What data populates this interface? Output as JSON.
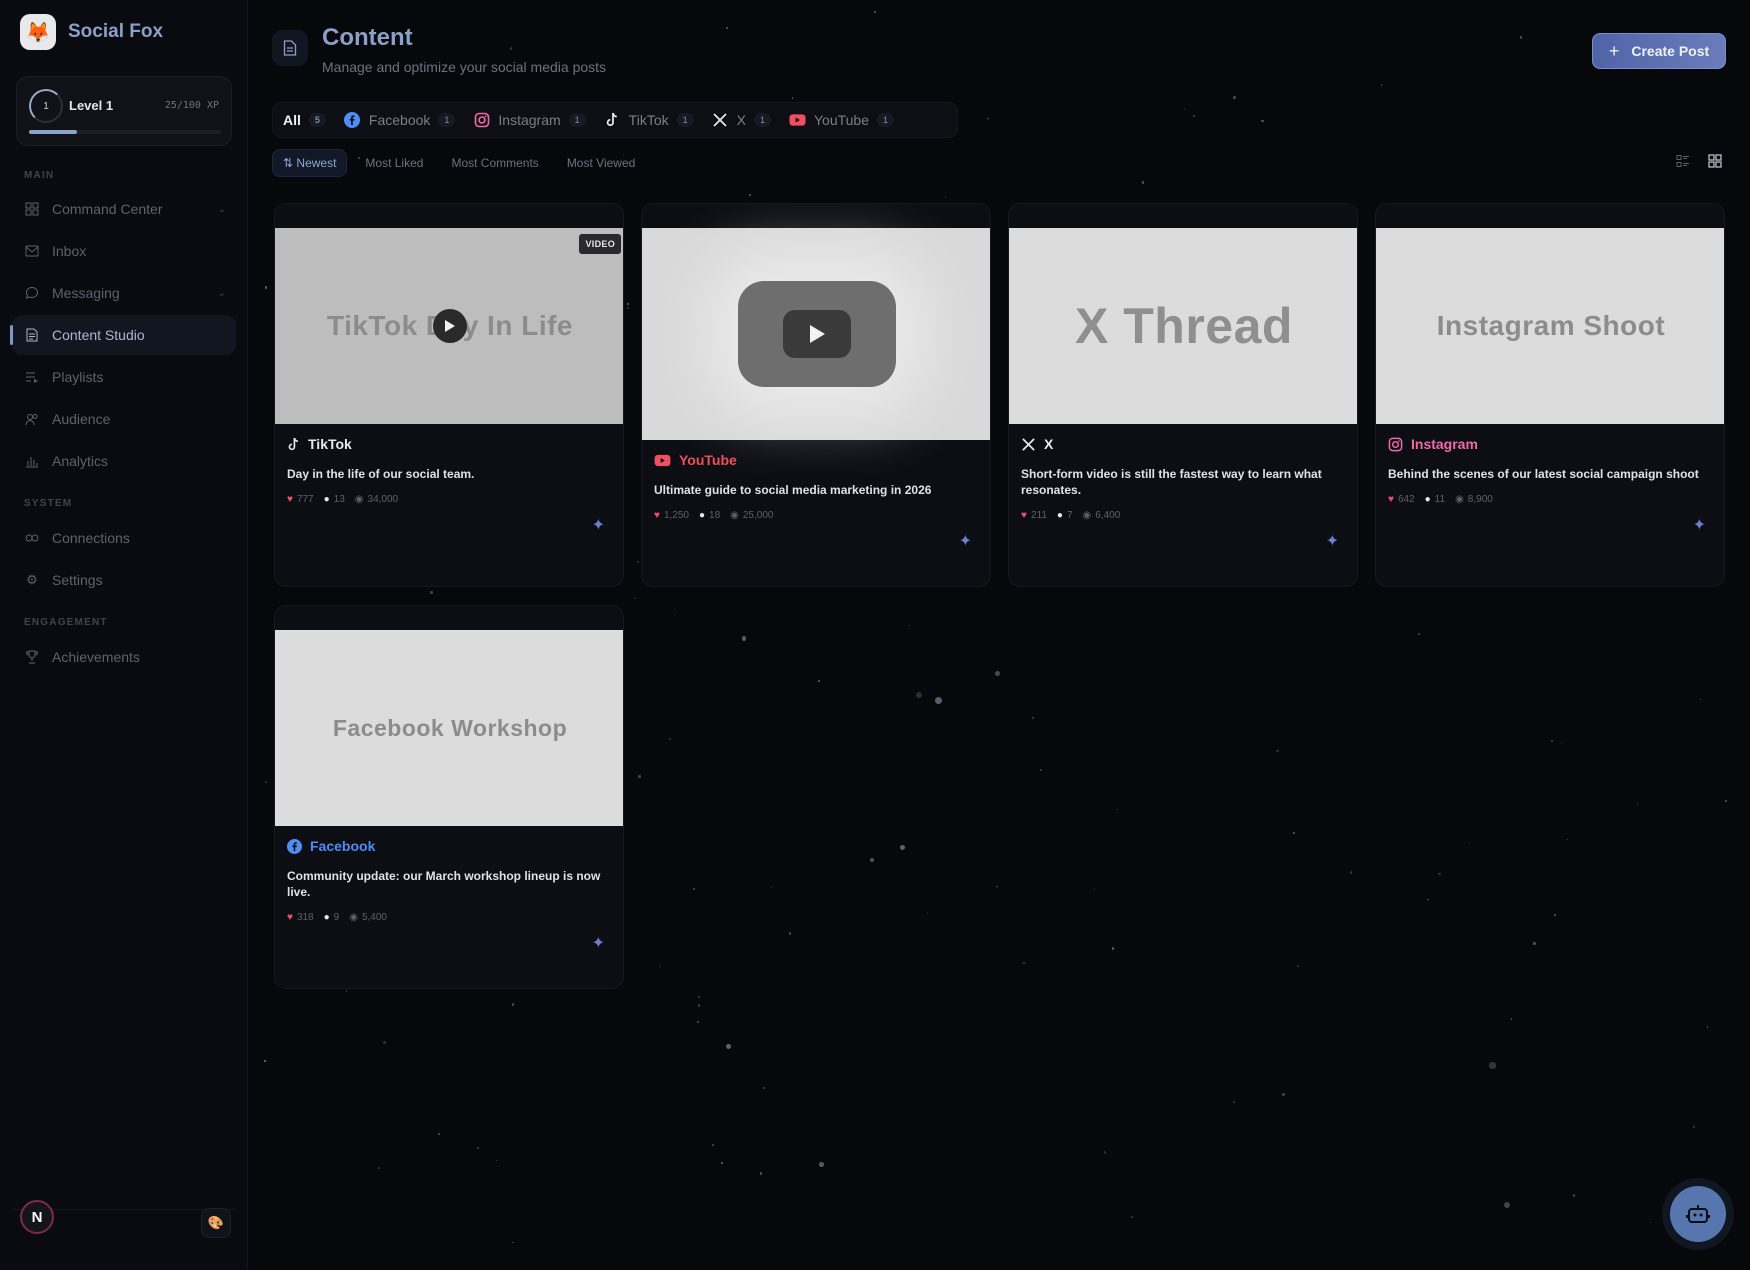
{
  "app": {
    "name": "Social Fox"
  },
  "level": {
    "label": "Level 1",
    "number": "1",
    "xp": "25/100 XP",
    "progress": 0.25
  },
  "nav": {
    "sections": {
      "main": "MAIN",
      "system": "SYSTEM",
      "engagement": "ENGAGEMENT"
    },
    "items": [
      {
        "label": "Command Center",
        "icon": "grid-icon",
        "chevron": true
      },
      {
        "label": "Inbox",
        "icon": "mail-icon"
      },
      {
        "label": "Messaging",
        "icon": "chat-icon",
        "chevron": true
      },
      {
        "label": "Content Studio",
        "icon": "document-icon",
        "active": true
      },
      {
        "label": "Playlists",
        "icon": "playlist-icon"
      },
      {
        "label": "Audience",
        "icon": "users-icon"
      },
      {
        "label": "Analytics",
        "icon": "bar-chart-icon"
      },
      {
        "label": "Connections",
        "icon": "link-icon"
      },
      {
        "label": "Settings",
        "icon": "gear-icon"
      },
      {
        "label": "Achievements",
        "icon": "trophy-icon"
      }
    ]
  },
  "user": {
    "initial": "N"
  },
  "header": {
    "title": "Content",
    "subtitle": "Manage and optimize your social media posts",
    "create_label": "Create Post"
  },
  "platform_tabs": [
    {
      "label": "All",
      "count": "5",
      "active": true
    },
    {
      "label": "Facebook",
      "count": "1",
      "icon": "facebook-icon"
    },
    {
      "label": "Instagram",
      "count": "1",
      "icon": "instagram-icon"
    },
    {
      "label": "TikTok",
      "count": "1",
      "icon": "tiktok-icon"
    },
    {
      "label": "X",
      "count": "1",
      "icon": "x-icon"
    },
    {
      "label": "YouTube",
      "count": "1",
      "icon": "youtube-icon"
    }
  ],
  "sort": {
    "options": [
      "Newest",
      "Most Liked",
      "Most Comments",
      "Most Viewed"
    ],
    "active": "Newest"
  },
  "posts": [
    {
      "platform": "TikTok",
      "color": "#e8e8ee",
      "thumb_text": "TikTok Day In Life",
      "badge": "VIDEO",
      "text": "Day in the life of our social team.",
      "likes": "777",
      "comments": "13",
      "views": "34,000"
    },
    {
      "platform": "YouTube",
      "color": "#ef4f5f",
      "text": "Ultimate guide to social media marketing in 2026",
      "likes": "1,250",
      "comments": "18",
      "views": "25,000"
    },
    {
      "platform": "X",
      "color": "#e8e8ee",
      "thumb_text": "X Thread",
      "text": "Short-form video is still the fastest way to learn what resonates.",
      "likes": "211",
      "comments": "7",
      "views": "6,400"
    },
    {
      "platform": "Instagram",
      "color": "#f06aa8",
      "thumb_text": "Instagram Shoot",
      "text": "Behind the scenes of our latest social campaign shoot",
      "likes": "642",
      "comments": "11",
      "views": "8,900"
    },
    {
      "platform": "Facebook",
      "color": "#4f8df5",
      "thumb_text": "Facebook Workshop",
      "text": "Community update: our March workshop lineup is now live.",
      "likes": "318",
      "comments": "9",
      "views": "5,400"
    }
  ]
}
